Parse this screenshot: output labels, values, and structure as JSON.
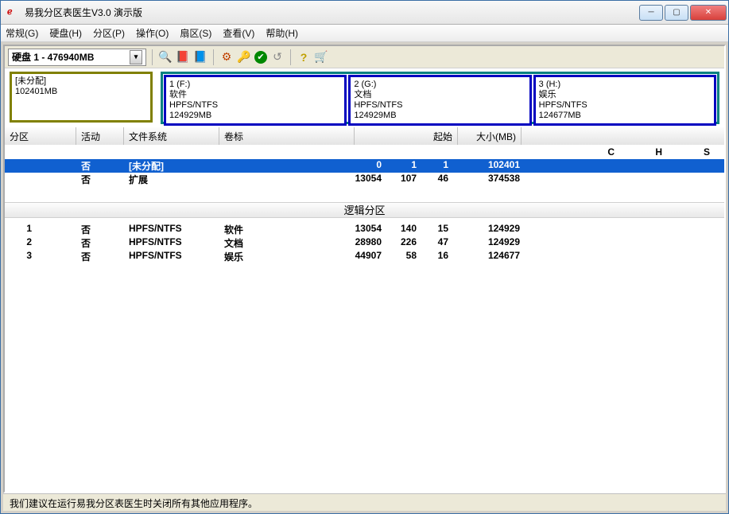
{
  "titlebar": {
    "title": "易我分区表医生V3.0 演示版",
    "app_icon": "ℯ"
  },
  "win_btns": {
    "min": "─",
    "max": "▢",
    "close": "✕"
  },
  "menu": {
    "general": "常规(G)",
    "disk": "硬盘(H)",
    "partition": "分区(P)",
    "operation": "操作(O)",
    "sector": "扇区(S)",
    "view": "查看(V)",
    "help": "帮助(H)"
  },
  "disk_selector": {
    "label": "硬盘 1 - 476940MB",
    "arrow": "▾"
  },
  "toolbar_icons": {
    "refresh": "🔍",
    "t2": "📕",
    "t3": "📘",
    "gear": "⚙",
    "key": "🔑",
    "check": "✔",
    "undo": "↺",
    "help": "?",
    "cart": "🛒"
  },
  "disk_map": {
    "unallocated": {
      "l1": "[未分配]",
      "l2": "102401MB"
    },
    "logicals": [
      {
        "l1": "1 (F:)",
        "l2": "软件",
        "l3": "HPFS/NTFS",
        "l4": "124929MB"
      },
      {
        "l1": "2 (G:)",
        "l2": "文档",
        "l3": "HPFS/NTFS",
        "l4": "124929MB"
      },
      {
        "l1": "3 (H:)",
        "l2": "娱乐",
        "l3": "HPFS/NTFS",
        "l4": "124677MB"
      }
    ]
  },
  "grid": {
    "headers": {
      "part": "分区",
      "active": "活动",
      "fs": "文件系统",
      "label": "卷标",
      "start": "起始",
      "size": "大小(MB)"
    },
    "chs": {
      "c": "C",
      "h": "H",
      "s": "S"
    },
    "top_rows": [
      {
        "id": "",
        "drive": "",
        "active": "否",
        "fs": "[未分配]",
        "label": "",
        "c": "0",
        "h": "1",
        "s": "1",
        "size": "102401",
        "selected": true
      },
      {
        "id": "",
        "drive": "",
        "active": "否",
        "fs": "扩展",
        "label": "",
        "c": "13054",
        "h": "107",
        "s": "46",
        "size": "374538",
        "selected": false
      }
    ],
    "logical_header": "逻辑分区",
    "logical_rows": [
      {
        "id": "1",
        "drive": "<F:>",
        "active": "否",
        "fs": "HPFS/NTFS",
        "label": "软件",
        "c": "13054",
        "h": "140",
        "s": "15",
        "size": "124929"
      },
      {
        "id": "2",
        "drive": "<G:>",
        "active": "否",
        "fs": "HPFS/NTFS",
        "label": "文档",
        "c": "28980",
        "h": "226",
        "s": "47",
        "size": "124929"
      },
      {
        "id": "3",
        "drive": "<H:>",
        "active": "否",
        "fs": "HPFS/NTFS",
        "label": "娱乐",
        "c": "44907",
        "h": "58",
        "s": "16",
        "size": "124677"
      }
    ]
  },
  "statusbar": {
    "text": "我们建议在运行易我分区表医生时关闭所有其他应用程序。"
  }
}
